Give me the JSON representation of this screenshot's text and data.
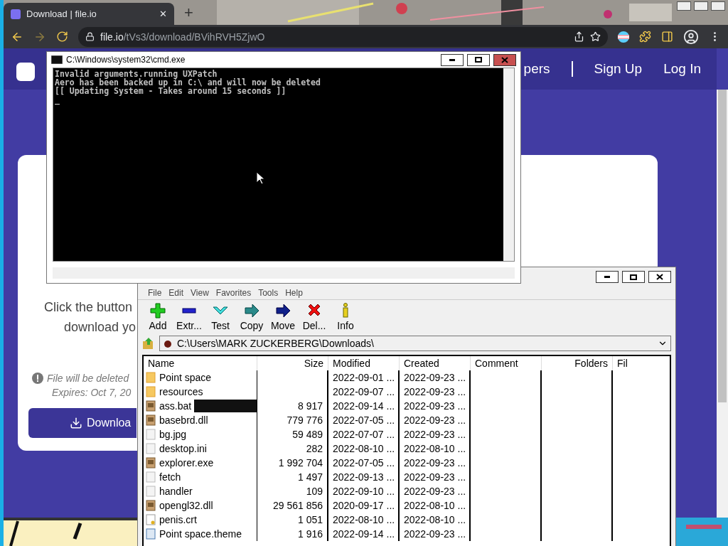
{
  "browser": {
    "tab": {
      "title": "Download | file.io",
      "close": "✕"
    },
    "new_tab": "+",
    "address": {
      "host": "file.io",
      "path": "/tVs3/download/BVihRVH5ZjwO"
    }
  },
  "site": {
    "nav": [
      "pers",
      "Sign Up",
      "Log In"
    ],
    "card": {
      "lines": [
        "Click the button",
        "download yo"
      ],
      "notice": [
        "File will be deleted",
        "Expires: Oct 7, 20"
      ],
      "button": "Downloa"
    }
  },
  "cmd": {
    "title": "C:\\Windows\\system32\\cmd.exe",
    "lines": [
      "Invalid arguments.running UXPatch",
      "Aero has been backed up in C:\\ and will now be deleted",
      "[[ Updating System - Takes around 15 seconds ]]"
    ],
    "cursor": "_"
  },
  "archiver": {
    "menu": [
      "File",
      "Edit",
      "View",
      "Favorites",
      "Tools",
      "Help"
    ],
    "tools": [
      {
        "label": "Add",
        "kind": "add"
      },
      {
        "label": "Extr...",
        "kind": "extract"
      },
      {
        "label": "Test",
        "kind": "test"
      },
      {
        "label": "Copy",
        "kind": "copy"
      },
      {
        "label": "Move",
        "kind": "move"
      },
      {
        "label": "Del...",
        "kind": "delete"
      },
      {
        "label": "Info",
        "kind": "info"
      }
    ],
    "path": "C:\\Users\\MARK ZUCKERBERG\\Downloads\\",
    "columns": [
      "Name",
      "Size",
      "Modified",
      "Created",
      "Comment",
      "Folders",
      "Fil"
    ],
    "rows": [
      {
        "name": "Point space",
        "size": "",
        "modified": "2022-09-01 ...",
        "created": "2022-09-23 ...",
        "kind": "folder",
        "selected": false
      },
      {
        "name": "resources",
        "size": "",
        "modified": "2022-09-07 ...",
        "created": "2022-09-23 ...",
        "kind": "folder",
        "selected": false
      },
      {
        "name": "ass.bat",
        "size": "8 917",
        "modified": "2022-09-14 ...",
        "created": "2022-09-23 ...",
        "kind": "app",
        "selected": true
      },
      {
        "name": "basebrd.dll",
        "size": "779 776",
        "modified": "2022-07-05 ...",
        "created": "2022-09-23 ...",
        "kind": "app",
        "selected": false
      },
      {
        "name": "bg.jpg",
        "size": "59 489",
        "modified": "2022-07-07 ...",
        "created": "2022-09-23 ...",
        "kind": "doc",
        "selected": false
      },
      {
        "name": "desktop.ini",
        "size": "282",
        "modified": "2022-08-10 ...",
        "created": "2022-08-10 ...",
        "kind": "doc",
        "selected": false
      },
      {
        "name": "explorer.exe",
        "size": "1 992 704",
        "modified": "2022-07-05 ...",
        "created": "2022-09-23 ...",
        "kind": "app",
        "selected": false
      },
      {
        "name": "fetch",
        "size": "1 497",
        "modified": "2022-09-13 ...",
        "created": "2022-09-23 ...",
        "kind": "doc",
        "selected": false
      },
      {
        "name": "handler",
        "size": "109",
        "modified": "2022-09-10 ...",
        "created": "2022-09-23 ...",
        "kind": "doc",
        "selected": false
      },
      {
        "name": "opengl32.dll",
        "size": "29 561 856",
        "modified": "2020-09-17 ...",
        "created": "2022-08-10 ...",
        "kind": "app",
        "selected": false
      },
      {
        "name": "penis.crt",
        "size": "1 051",
        "modified": "2022-08-10 ...",
        "created": "2022-08-10 ...",
        "kind": "cert",
        "selected": false
      },
      {
        "name": "Point space.theme",
        "size": "1 916",
        "modified": "2022-09-14 ...",
        "created": "2022-09-23 ...",
        "kind": "theme",
        "selected": false
      }
    ]
  }
}
